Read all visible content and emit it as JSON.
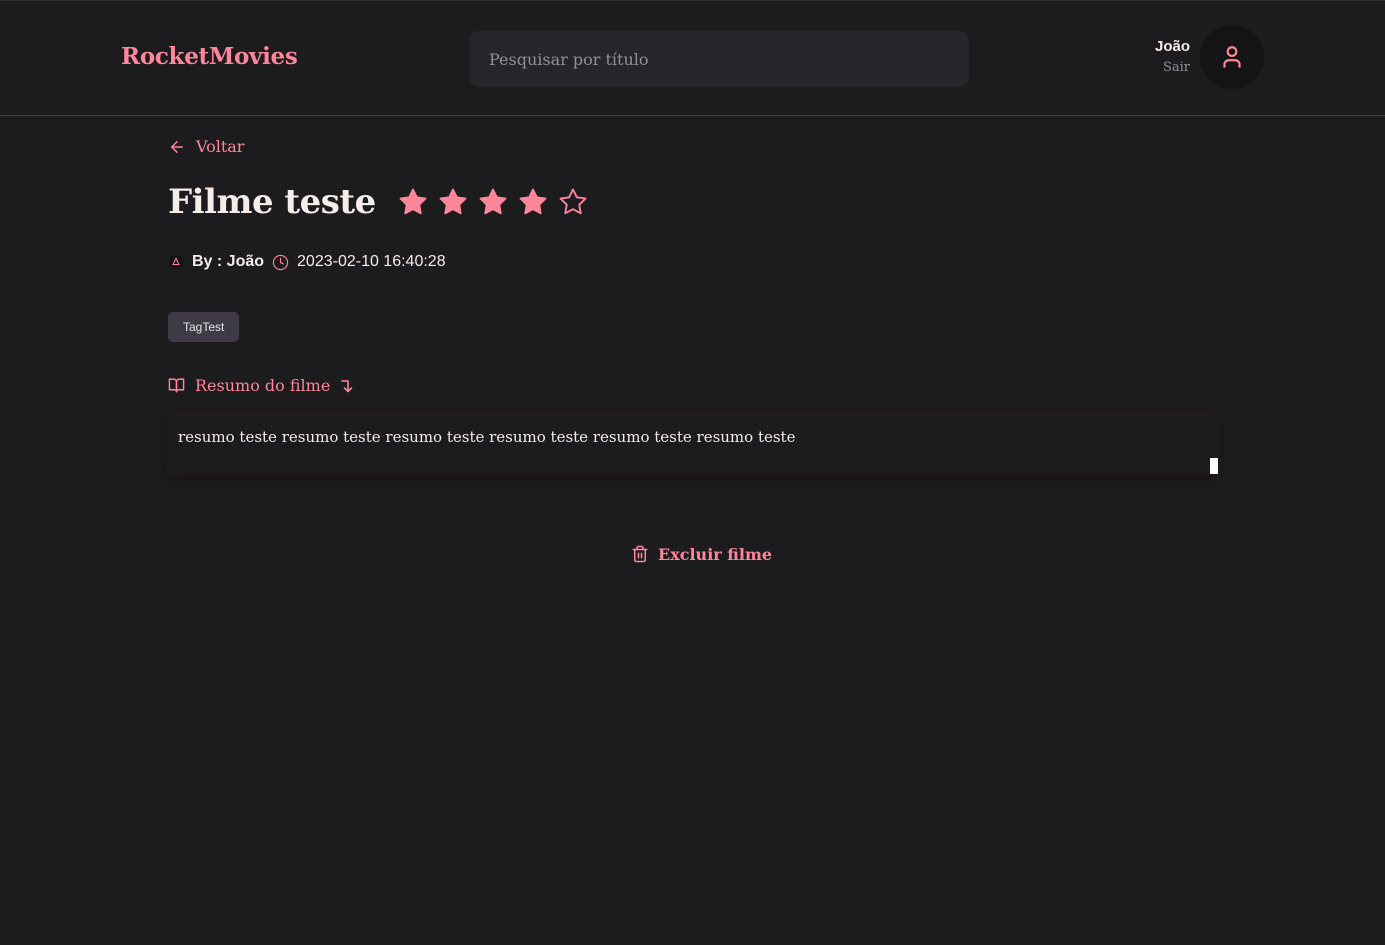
{
  "header": {
    "brand": "RocketMovies",
    "search_placeholder": "Pesquisar por título",
    "user_name": "João",
    "logout_label": "Sair",
    "avatar_icon": "user-icon"
  },
  "back_label": "Voltar",
  "movie": {
    "title": "Filme teste",
    "rating": 4,
    "rating_max": 5,
    "author_label": "By : João",
    "created_at": "2023-02-10 16:40:28",
    "tags": [
      "TagTest"
    ],
    "summary_heading": "Resumo do filme",
    "summary": "resumo teste resumo teste resumo teste resumo teste resumo teste resumo teste"
  },
  "delete_label": "Excluir filme",
  "colors": {
    "background": "#1c1b1e",
    "accent": "#ff859b",
    "text": "#f4ede8",
    "muted": "#948f99",
    "input_bg": "#262529",
    "tag_bg": "#3e3b47"
  }
}
